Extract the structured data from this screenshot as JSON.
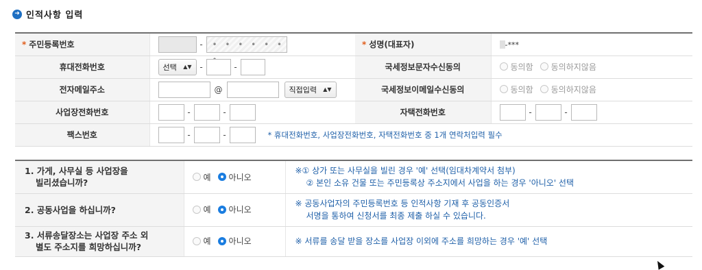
{
  "section": {
    "title": "인적사항 입력",
    "icon": "arrow-right-circle-icon"
  },
  "info": {
    "rrn": {
      "label": "주민등록번호",
      "dash": "-",
      "masked_back": "• • • • • • •"
    },
    "name": {
      "label": "성명(대표자)",
      "value": "-***"
    },
    "mobile": {
      "label": "휴대전화번호",
      "select": "선택",
      "dash": "-"
    },
    "sms_consent": {
      "label": "국세정보문자수신동의",
      "agree": "동의함",
      "disagree": "동의하지않음"
    },
    "email": {
      "label": "전자메일주소",
      "at": "@",
      "domain_select": "직접입력"
    },
    "email_consent": {
      "label": "국세정보이메일수신동의",
      "agree": "동의함",
      "disagree": "동의하지않음"
    },
    "biz_phone": {
      "label": "사업장전화번호",
      "dash": "-"
    },
    "home_phone": {
      "label": "자택전화번호",
      "dash": "-"
    },
    "fax": {
      "label": "팩스번호",
      "dash": "-"
    },
    "required_mark": "*",
    "contact_note": "* 휴대전화번호, 사업장전화번호, 자택전화번호 중 1개 연락처입력 필수"
  },
  "questions": [
    {
      "line1": "1. 가게, 사무실 등 사업장을",
      "line2": "빌리셨습니까?",
      "yes": "예",
      "no": "아니오",
      "desc1": "※① 상가 또는 사무실을 빌린 경우 '예' 선택(임대차계약서 첨부)",
      "desc2": "② 본인 소유 건물 또는 주민등록상 주소지에서 사업을 하는 경우 '아니오' 선택"
    },
    {
      "line1": "2. 공동사업을 하십니까?",
      "yes": "예",
      "no": "아니오",
      "desc1": "※ 공동사업자의 주민등록번호 등 인적사항 기재 후 공동인증서",
      "desc2": "서명을 통하여 신청서를 최종 제출 하실 수 있습니다."
    },
    {
      "line1": "3. 서류송달장소는 사업장 주소 외",
      "line2": "별도 주소지를 희망하십니까?",
      "yes": "예",
      "no": "아니오",
      "desc1": "※ 서류를 송달 받을 장소를 사업장 이외에 주소를 희망하는 경우 '예' 선택"
    }
  ],
  "colors": {
    "accent": "#1a7de0",
    "required": "#e05c1a",
    "note": "#1e5fa8"
  }
}
